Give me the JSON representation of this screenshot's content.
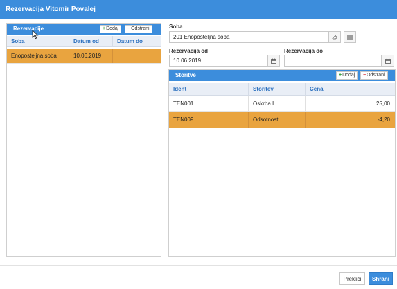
{
  "window": {
    "title": "Rezervacija Vitomir Povalej"
  },
  "left_panel": {
    "title": "Rezervacije",
    "add_label": "Dodaj",
    "remove_label": "Odstrani",
    "columns": [
      "Soba",
      "Datum od",
      "Datum do"
    ],
    "rows": [
      {
        "soba": "Enoposteljna soba",
        "datum_od": "10.06.2019",
        "datum_do": "",
        "selected": true
      }
    ]
  },
  "form": {
    "soba_label": "Soba",
    "soba_value": "201 Enoposteljna soba",
    "rez_od_label": "Rezervacija od",
    "rez_od_value": "10.06.2019",
    "rez_do_label": "Rezervacija do",
    "rez_do_value": ""
  },
  "services_panel": {
    "title": "Storitve",
    "add_label": "Dodaj",
    "remove_label": "Odstrani",
    "columns": [
      "Ident",
      "Storitev",
      "Cena"
    ],
    "rows": [
      {
        "ident": "TEN001",
        "storitev": "Oskrba I",
        "cena": "25,00",
        "selected": false
      },
      {
        "ident": "TEN009",
        "storitev": "Odsotnost",
        "cena": "-4,20",
        "selected": true
      }
    ]
  },
  "footer": {
    "cancel_label": "Prekliči",
    "save_label": "Shrani"
  },
  "colors": {
    "accent": "#3c8ddc",
    "selection": "#e9a43f",
    "add": "#2e9a35",
    "remove": "#d9333a"
  },
  "icons": {
    "clear": "eraser-icon",
    "list": "list-icon",
    "calendar": "calendar-icon",
    "cursor": "mouse-pointer-icon"
  }
}
